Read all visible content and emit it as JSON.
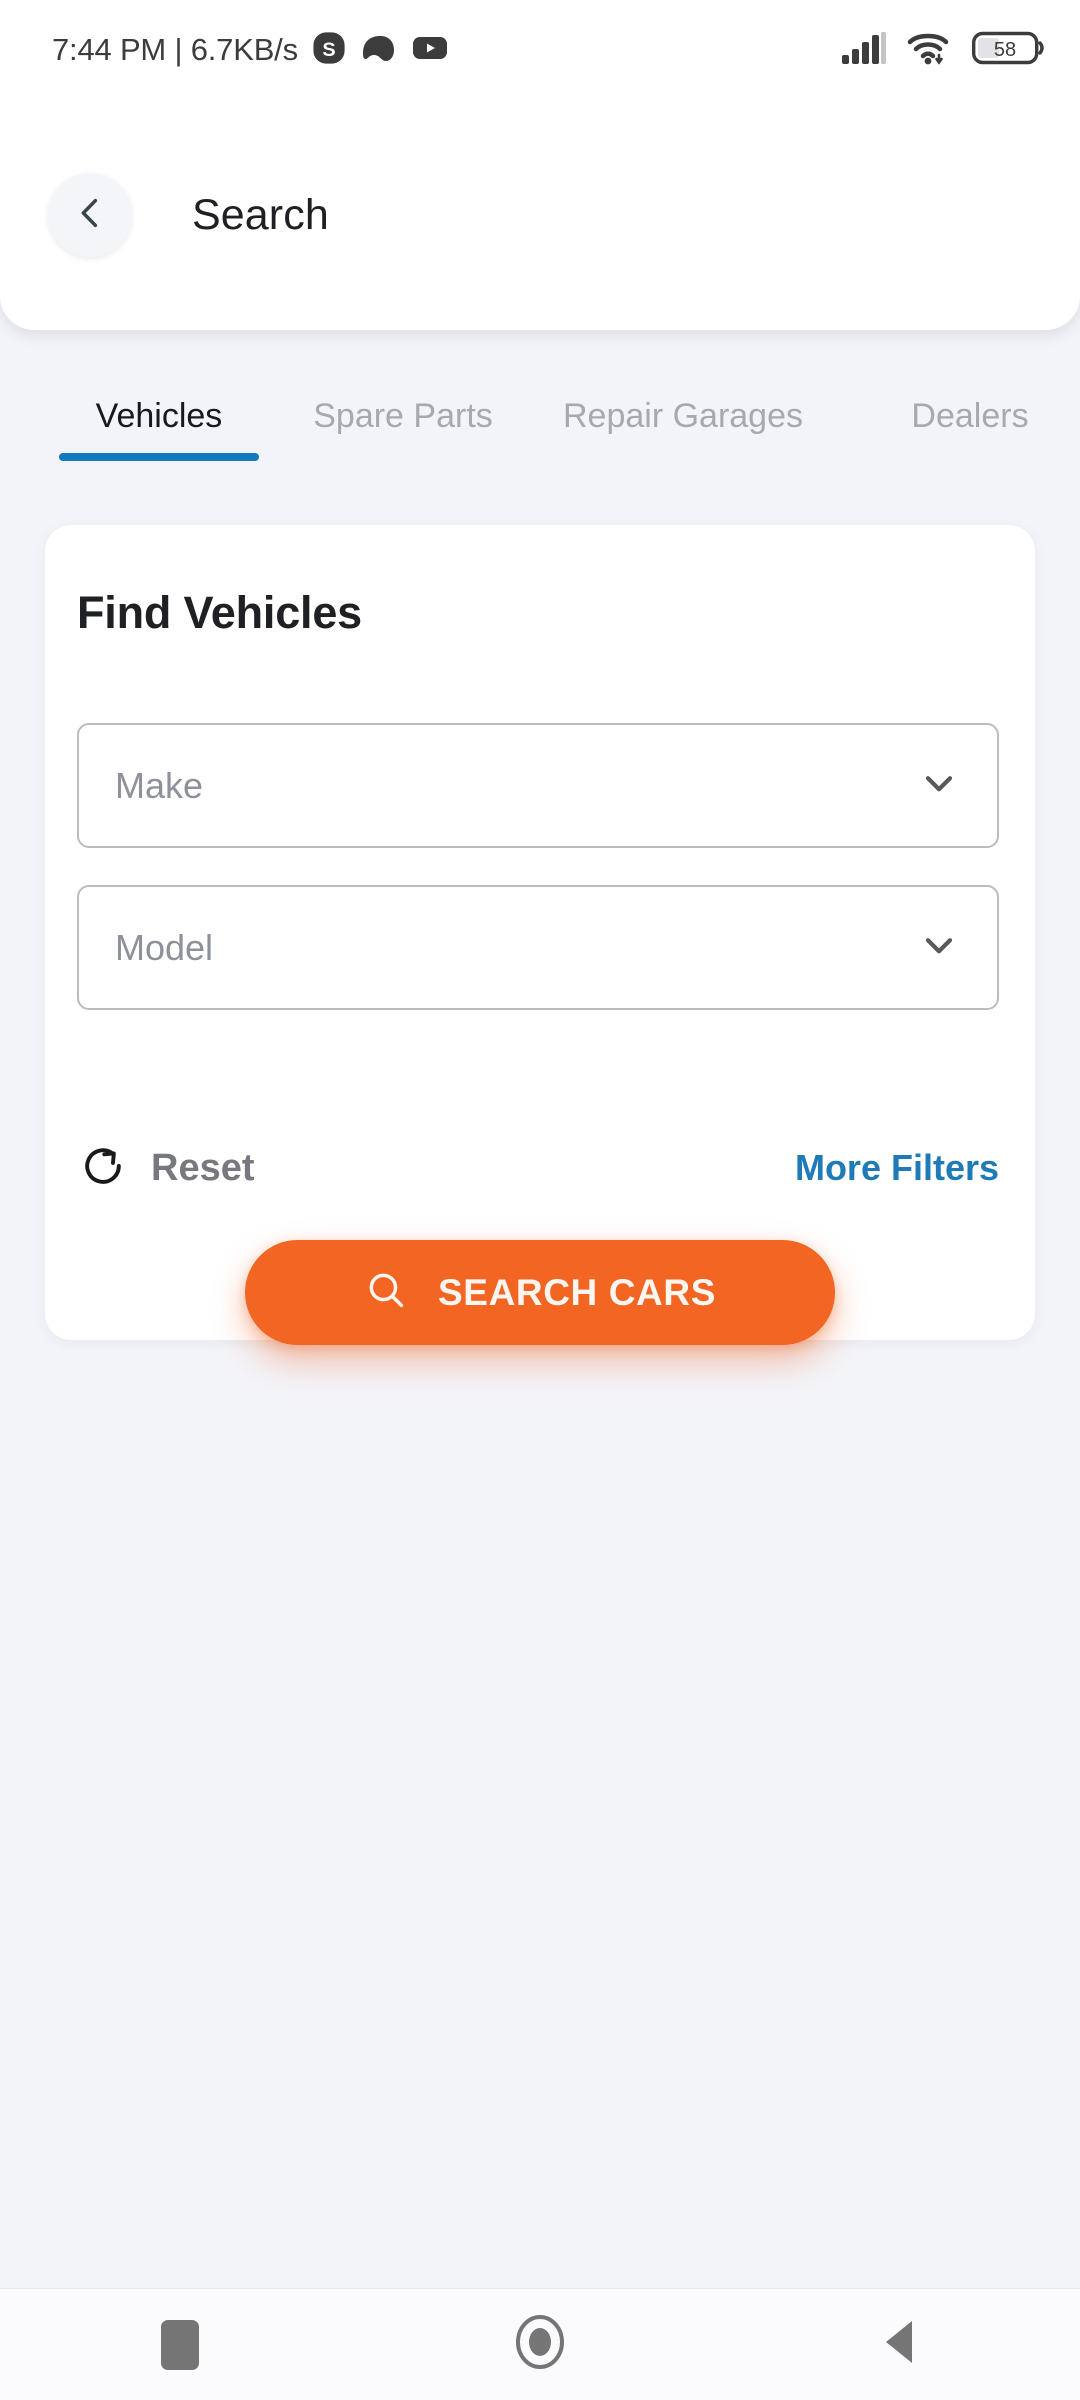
{
  "status_bar": {
    "time_and_speed": "7:44 PM | 6.7KB/s",
    "app_icons": [
      "skype-icon",
      "game-controller-icon",
      "youtube-icon"
    ],
    "signal_icon": "cellular-signal-icon",
    "wifi_icon": "wifi-icon",
    "battery_icon": "battery-icon",
    "battery_level": "58"
  },
  "header": {
    "back_icon": "chevron-left-icon",
    "title": "Search"
  },
  "tabs": {
    "items": [
      {
        "label": "Vehicles",
        "active": true
      },
      {
        "label": "Spare Parts",
        "active": false
      },
      {
        "label": "Repair Garages",
        "active": false
      },
      {
        "label": "Dealers",
        "active": false
      }
    ],
    "active_indicator_color": "#1379bf"
  },
  "card": {
    "title": "Find Vehicles",
    "fields": [
      {
        "name": "make",
        "placeholder": "Make",
        "value": "",
        "chevron": "chevron-down-icon"
      },
      {
        "name": "model",
        "placeholder": "Model",
        "value": "",
        "chevron": "chevron-down-icon"
      }
    ],
    "reset": {
      "label": "Reset",
      "icon": "rotate-right-icon"
    },
    "more_filters": {
      "label": "More Filters",
      "color": "#1e7bb8"
    },
    "search_button": {
      "label": "SEARCH CARS",
      "icon": "search-icon",
      "color": "#f26522"
    }
  },
  "navbar": {
    "recents_icon": "square-recents-icon",
    "home_icon": "circle-home-icon",
    "back_icon": "triangle-back-icon"
  },
  "theme": {
    "page_background": "#f3f4f9",
    "card_background": "#ffffff",
    "accent_blue": "#1379bf",
    "accent_orange": "#f26522"
  }
}
